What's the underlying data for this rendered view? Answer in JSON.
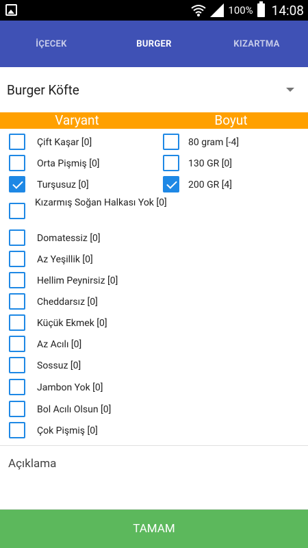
{
  "status_bar": {
    "battery": "100%",
    "time": "14:08",
    "icons": [
      "image-icon",
      "wifi-icon",
      "signal-icon",
      "battery-icon"
    ]
  },
  "tabs": [
    {
      "label": "İÇECEK",
      "active": false
    },
    {
      "label": "BURGER",
      "active": true
    },
    {
      "label": "KIZARTMA",
      "active": false
    }
  ],
  "product": {
    "selected": "Burger Köfte"
  },
  "headers": {
    "variant": "Varyant",
    "size": "Boyut"
  },
  "variants": [
    {
      "label": "Çift Kaşar [0]",
      "checked": false
    },
    {
      "label": "Orta Pişmiş [0]",
      "checked": false
    },
    {
      "label": "Turşusuz [0]",
      "checked": true
    },
    {
      "label": "Kızarmış Soğan Halkası Yok [0]",
      "checked": false
    },
    {
      "label": "Domatessiz [0]",
      "checked": false
    },
    {
      "label": "Az Yeşillik [0]",
      "checked": false
    },
    {
      "label": "Hellim Peynirsiz [0]",
      "checked": false
    },
    {
      "label": "Cheddarsız [0]",
      "checked": false
    },
    {
      "label": "Küçük Ekmek [0]",
      "checked": false
    },
    {
      "label": "Az Acılı [0]",
      "checked": false
    },
    {
      "label": "Sossuz [0]",
      "checked": false
    },
    {
      "label": "Jambon Yok [0]",
      "checked": false
    },
    {
      "label": "Bol Acılı Olsun [0]",
      "checked": false
    },
    {
      "label": "Çok Pişmiş [0]",
      "checked": false
    }
  ],
  "sizes": [
    {
      "label": "80 gram [-4]",
      "checked": false
    },
    {
      "label": "130 GR [0]",
      "checked": false
    },
    {
      "label": "200 GR [4]",
      "checked": true
    }
  ],
  "notes": {
    "placeholder": "Açıklama"
  },
  "submit": {
    "label": "TAMAM"
  },
  "colors": {
    "tabbar": "#3f51b5",
    "header": "#ffa000",
    "checkbox": "#1e88e5",
    "submit": "#5cb85c"
  }
}
